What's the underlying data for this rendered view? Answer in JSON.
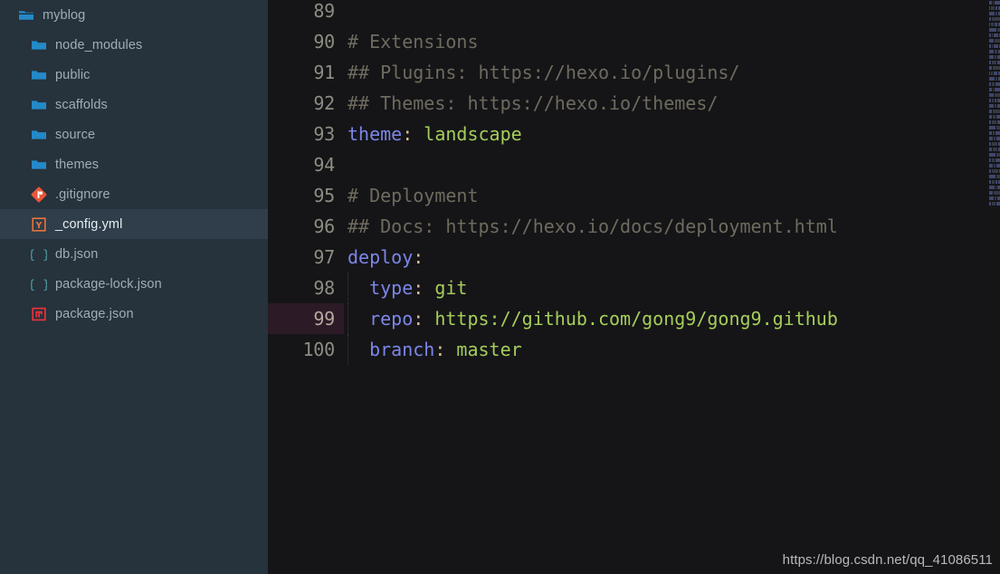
{
  "sidebar": {
    "items": [
      {
        "label": "myblog",
        "icon": "folder-open-icon",
        "indent": 0,
        "type": "folder-open",
        "selected": false
      },
      {
        "label": "node_modules",
        "icon": "folder-icon",
        "indent": 1,
        "type": "folder",
        "selected": false
      },
      {
        "label": "public",
        "icon": "folder-icon",
        "indent": 1,
        "type": "folder",
        "selected": false
      },
      {
        "label": "scaffolds",
        "icon": "folder-icon",
        "indent": 1,
        "type": "folder",
        "selected": false
      },
      {
        "label": "source",
        "icon": "folder-icon",
        "indent": 1,
        "type": "folder",
        "selected": false
      },
      {
        "label": "themes",
        "icon": "folder-icon",
        "indent": 1,
        "type": "folder",
        "selected": false
      },
      {
        "label": ".gitignore",
        "icon": "git-icon",
        "indent": 1,
        "type": "git",
        "selected": false
      },
      {
        "label": "_config.yml",
        "icon": "yaml-icon",
        "indent": 1,
        "type": "yaml",
        "selected": true
      },
      {
        "label": "db.json",
        "icon": "json-icon",
        "indent": 1,
        "type": "json",
        "selected": false
      },
      {
        "label": "package-lock.json",
        "icon": "json-icon",
        "indent": 1,
        "type": "json",
        "selected": false
      },
      {
        "label": "package.json",
        "icon": "npm-icon",
        "indent": 1,
        "type": "npm",
        "selected": false
      }
    ]
  },
  "editor": {
    "file_type": "yaml",
    "current_line": 99,
    "first_visible_line": 89,
    "lines": [
      {
        "num": "89",
        "tokens": [],
        "current": false,
        "indent_guide": false
      },
      {
        "num": "90",
        "tokens": [
          {
            "t": "comment",
            "s": "# Extensions"
          }
        ],
        "current": false,
        "indent_guide": false
      },
      {
        "num": "91",
        "tokens": [
          {
            "t": "comment",
            "s": "## Plugins: https://hexo.io/plugins/"
          }
        ],
        "current": false,
        "indent_guide": false
      },
      {
        "num": "92",
        "tokens": [
          {
            "t": "comment",
            "s": "## Themes: https://hexo.io/themes/"
          }
        ],
        "current": false,
        "indent_guide": false
      },
      {
        "num": "93",
        "tokens": [
          {
            "t": "key",
            "s": "theme"
          },
          {
            "t": "colon",
            "s": ":"
          },
          {
            "t": "value",
            "s": " landscape"
          }
        ],
        "current": false,
        "indent_guide": false
      },
      {
        "num": "94",
        "tokens": [],
        "current": false,
        "indent_guide": false
      },
      {
        "num": "95",
        "tokens": [
          {
            "t": "comment",
            "s": "# Deployment"
          }
        ],
        "current": false,
        "indent_guide": false
      },
      {
        "num": "96",
        "tokens": [
          {
            "t": "comment",
            "s": "## Docs: https://hexo.io/docs/deployment.html"
          }
        ],
        "current": false,
        "indent_guide": false
      },
      {
        "num": "97",
        "tokens": [
          {
            "t": "key",
            "s": "deploy"
          },
          {
            "t": "colon",
            "s": ":"
          }
        ],
        "current": false,
        "indent_guide": false
      },
      {
        "num": "98",
        "tokens": [
          {
            "t": "key",
            "s": "  type"
          },
          {
            "t": "colon",
            "s": ":"
          },
          {
            "t": "value",
            "s": " git"
          }
        ],
        "current": false,
        "indent_guide": true
      },
      {
        "num": "99",
        "tokens": [
          {
            "t": "key",
            "s": "  repo"
          },
          {
            "t": "colon",
            "s": ":"
          },
          {
            "t": "value",
            "s": " https://github.com/gong9/gong9.github"
          }
        ],
        "current": true,
        "indent_guide": true
      },
      {
        "num": "100",
        "tokens": [
          {
            "t": "key",
            "s": "  branch"
          },
          {
            "t": "colon",
            "s": ":"
          },
          {
            "t": "value",
            "s": " master"
          }
        ],
        "current": false,
        "indent_guide": true
      }
    ]
  },
  "minimap": {
    "rows": [
      [
        6,
        3,
        14
      ],
      [
        4,
        12,
        5,
        7
      ],
      [
        9,
        4,
        3
      ],
      [
        5,
        18
      ],
      [
        3,
        7,
        9,
        4
      ],
      [
        11,
        5
      ],
      [
        4,
        4,
        12,
        3
      ],
      [
        7,
        9
      ],
      [
        5,
        3,
        14,
        4
      ],
      [
        8,
        6,
        3
      ],
      [
        12,
        4,
        7
      ],
      [
        4,
        9,
        5
      ],
      [
        6,
        14
      ],
      [
        3,
        5,
        8,
        6
      ],
      [
        10,
        4,
        3
      ],
      [
        5,
        7,
        12
      ],
      [
        4,
        3,
        9
      ],
      [
        8,
        11
      ],
      [
        6,
        4,
        5,
        7
      ],
      [
        9,
        3,
        6
      ],
      [
        4,
        13
      ],
      [
        7,
        5,
        9
      ],
      [
        3,
        8,
        4
      ],
      [
        11,
        6
      ],
      [
        5,
        4,
        10
      ],
      [
        8,
        3,
        7
      ],
      [
        4,
        12,
        3
      ],
      [
        6,
        9,
        4
      ],
      [
        10,
        5
      ],
      [
        3,
        6,
        11
      ],
      [
        7,
        4,
        8
      ],
      [
        5,
        13,
        3
      ],
      [
        9,
        6
      ],
      [
        4,
        7,
        5,
        4
      ],
      [
        12,
        3,
        6
      ],
      [
        6,
        10
      ],
      [
        8,
        4,
        5
      ],
      [
        3,
        9,
        7
      ]
    ]
  },
  "watermark": {
    "text": "https://blog.csdn.net/qq_41086511"
  },
  "colors": {
    "sidebar_bg": "#26323c",
    "sidebar_selected_bg": "#2f3e4a",
    "editor_bg": "#151518",
    "current_line_gutter": "#2c1a26",
    "folder_icon": "#2489c8",
    "yaml_icon": "#e8733a",
    "json_icon": "#52a1a8",
    "npm_icon": "#e8323c",
    "git_icon": "#e8563a",
    "comment": "#6e6b5e",
    "key": "#7c86e8",
    "value": "#a6ce5a",
    "colon": "#d7c08a",
    "line_number": "#8d8d82"
  }
}
